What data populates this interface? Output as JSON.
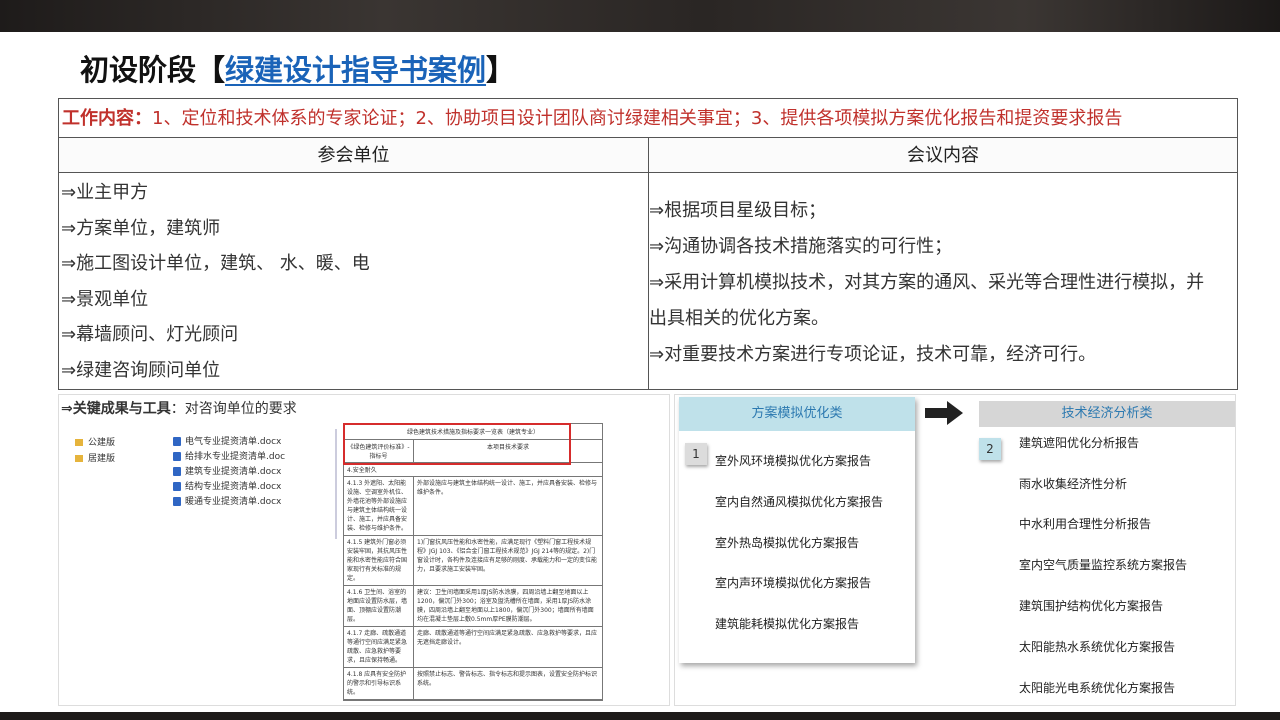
{
  "title": {
    "prefix": "初设阶段【",
    "link": "绿建设计指导书案例",
    "suffix": "】"
  },
  "table": {
    "work_label": "工作内容：",
    "work_text": "1、定位和技术体系的专家论证；2、协助项目设计团队商讨绿建相关事宜；3、提供各项模拟方案优化报告和提资要求报告",
    "col_left_header": "参会单位",
    "col_right_header": "会议内容",
    "left_items": [
      "⇒业主甲方",
      "⇒方案单位，建筑师",
      "⇒施工图设计单位，建筑、 水、暖、电",
      "⇒景观单位",
      "⇒幕墙顾问、灯光顾问",
      "⇒绿建咨询顾问单位"
    ],
    "right_items": [
      "⇒根据项目星级目标；",
      "⇒沟通协调各技术措施落实的可行性；",
      "⇒采用计算机模拟技术，对其方案的通风、采光等合理性进行模拟，并出具相关的优化方案。",
      "⇒对重要技术方案进行专项论证，技术可靠，经济可行。"
    ]
  },
  "key_results": {
    "label": "⇒关键成果与工具",
    "text": "：对咨询单位的要求",
    "folders": [
      "公建版",
      "居建版"
    ],
    "files": [
      "电气专业提资清单.docx",
      "给排水专业提资清单.doc",
      "建筑专业提资清单.docx",
      "结构专业提资清单.docx",
      "暖通专业提资清单.docx"
    ],
    "mini_table": {
      "title": "绿色建筑技术措施及指标要求一览表（建筑专业）",
      "h1": "《绿色建筑评价标准》-指标号",
      "h2": "本项目技术要求",
      "section": "4.安全耐久",
      "rows": [
        {
          "a": "4.1.3 外遮阳、太阳能设施、空调室外机位、外墙花池等外部设施应与建筑主体结构统一设计、施工，并应具备安装、检修与维护条件。",
          "b": "外部设施应与建筑主体结构统一设计、施工，并应具备安装、检修与维护条件。"
        },
        {
          "a": "4.1.5 建筑外门窗必须安装牢固，其抗风压性能和水密性能应符合国家现行有关标准的规定。",
          "b": "1)门窗抗风压性能和水密性能，应满足现行《塑料门窗工程技术规程》JGJ 103、《铝合金门窗工程技术规范》JGJ 214等的规定。2)门窗设计时，各构件及连接应有足够的刚度、承载能力和一定的变位能力，且要求施工安装牢固。"
        },
        {
          "a": "4.1.6 卫生间、浴室的地面应设置防水层，墙面、顶棚应设置防潮层。",
          "b": "建议：卫生间墙面采用1厚JS防水涂膜，四周沿墙上翻至地面以上1200，偏沉门外300；浴室及盥洗槽所在墙面，采用1厚JS防水涂膜，四周沿墙上翻至地面以上1800，偏沉门外300；墙面所有墙面均在混凝土垫层上敷0.5mm厚PE膜防潮层。"
        },
        {
          "a": "4.1.7 走廊、疏散通道等通行空间应满足紧急疏散、应急救护等要求，且应保持畅通。",
          "b": "走廊、疏散通道等通行空间应满足紧急疏散、应急救护等要求，且应无遮挡走廊设计。"
        },
        {
          "a": "4.1.8 应具有安全防护的警示和引导标识系统。",
          "b": "按照禁止标志、警告标志、指令标志和提示图表，设置安全防护标识系统。"
        }
      ]
    }
  },
  "options": {
    "col1_header": "方案模拟优化类",
    "col1_number": "1",
    "col1_items": [
      "室外风环境模拟优化方案报告",
      "室内自然通风模拟优化方案报告",
      "室外热岛模拟优化方案报告",
      "室内声环境模拟优化方案报告",
      "建筑能耗模拟优化方案报告"
    ],
    "col2_header": "技术经济分析类",
    "col2_number": "2",
    "col2_items": [
      "建筑遮阳优化分析报告",
      "雨水收集经济性分析",
      "中水利用合理性分析报告",
      "室内空气质量监控系统方案报告",
      "建筑围护结构优化方案报告",
      "太阳能热水系统优化方案报告",
      "太阳能光电系统优化方案报告"
    ]
  }
}
